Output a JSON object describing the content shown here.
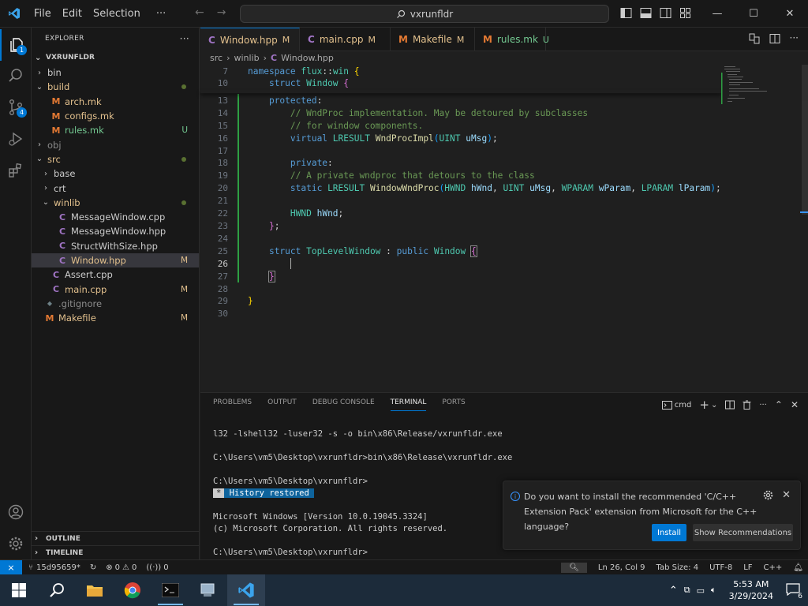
{
  "titlebar": {
    "menu": [
      "File",
      "Edit",
      "Selection",
      "···"
    ],
    "search_text": "vxrunfldr"
  },
  "activitybar": {
    "explorer_badge": "1",
    "scm_badge": "4"
  },
  "sidebar": {
    "title": "EXPLORER",
    "more": "···",
    "root": "VXRUNFLDR",
    "tree": [
      {
        "label": "bin",
        "depth": 1,
        "chevron": "›",
        "icon": "",
        "status": ""
      },
      {
        "label": "build",
        "depth": 1,
        "chevron": "⌄",
        "icon": "",
        "status": "dot",
        "color": "mod"
      },
      {
        "label": "arch.mk",
        "depth": 2,
        "chevron": "",
        "icon": "M",
        "status": "",
        "color": "mod"
      },
      {
        "label": "configs.mk",
        "depth": 2,
        "chevron": "",
        "icon": "M",
        "status": "",
        "color": "mod"
      },
      {
        "label": "rules.mk",
        "depth": 2,
        "chevron": "",
        "icon": "M",
        "status": "U",
        "color": "unt"
      },
      {
        "label": "obj",
        "depth": 1,
        "chevron": "›",
        "icon": "",
        "status": "",
        "color": "dim"
      },
      {
        "label": "src",
        "depth": 1,
        "chevron": "⌄",
        "icon": "",
        "status": "dot",
        "color": "mod"
      },
      {
        "label": "base",
        "depth": 2,
        "chevron": "›",
        "icon": "",
        "status": ""
      },
      {
        "label": "crt",
        "depth": 2,
        "chevron": "›",
        "icon": "",
        "status": ""
      },
      {
        "label": "winlib",
        "depth": 2,
        "chevron": "⌄",
        "icon": "",
        "status": "dot",
        "color": "mod"
      },
      {
        "label": "MessageWindow.cpp",
        "depth": 3,
        "chevron": "",
        "icon": "C",
        "status": ""
      },
      {
        "label": "MessageWindow.hpp",
        "depth": 3,
        "chevron": "",
        "icon": "C",
        "status": ""
      },
      {
        "label": "StructWithSize.hpp",
        "depth": 3,
        "chevron": "",
        "icon": "C",
        "status": ""
      },
      {
        "label": "Window.hpp",
        "depth": 3,
        "chevron": "",
        "icon": "C",
        "status": "M",
        "color": "mod",
        "selected": true
      },
      {
        "label": "Assert.cpp",
        "depth": 2,
        "chevron": "",
        "icon": "C",
        "status": ""
      },
      {
        "label": "main.cpp",
        "depth": 2,
        "chevron": "",
        "icon": "C",
        "status": "M",
        "color": "mod"
      },
      {
        "label": ".gitignore",
        "depth": 1,
        "chevron": "",
        "icon": "◆",
        "status": "",
        "color": "dim"
      },
      {
        "label": "Makefile",
        "depth": 1,
        "chevron": "",
        "icon": "M",
        "status": "M",
        "color": "mod"
      }
    ],
    "outline": "OUTLINE",
    "timeline": "TIMELINE"
  },
  "tabs": [
    {
      "label": "Window.hpp",
      "status": "M",
      "active": true,
      "dirty": true,
      "icon": "C"
    },
    {
      "label": "main.cpp",
      "status": "M",
      "active": false,
      "icon": "C"
    },
    {
      "label": "Makefile",
      "status": "M",
      "active": false,
      "icon": "M"
    },
    {
      "label": "rules.mk",
      "status": "U",
      "active": false,
      "icon": "M"
    }
  ],
  "breadcrumb": [
    "src",
    "winlib",
    "Window.hpp"
  ],
  "editor": {
    "lines": [
      {
        "n": "7",
        "g": false,
        "html": "<span class='kw'>namespace</span> <span class='ty'>flux</span><span class='op'>::</span><span class='ty'>win</span> <span class='br1'>{</span>"
      },
      {
        "n": "10",
        "g": false,
        "html": "    <span class='kw'>struct</span> <span class='ty'>Window</span> <span class='br2'>{</span>"
      },
      {
        "n": "13",
        "g": true,
        "html": "    <span class='kw'>protected</span><span class='op'>:</span>"
      },
      {
        "n": "14",
        "g": true,
        "html": "        <span class='cm'>// WndProc implementation. May be detoured by subclasses</span>"
      },
      {
        "n": "15",
        "g": true,
        "html": "        <span class='cm'>// for window components.</span>"
      },
      {
        "n": "16",
        "g": true,
        "html": "        <span class='kw'>virtual</span> <span class='ty'>LRESULT</span> <span class='fn'>WndProcImpl</span><span class='br3'>(</span><span class='ty'>UINT</span> <span class='pm'>uMsg</span><span class='br3'>)</span><span class='op'>;</span>"
      },
      {
        "n": "17",
        "g": true,
        "html": ""
      },
      {
        "n": "18",
        "g": true,
        "html": "        <span class='kw'>private</span><span class='op'>:</span>"
      },
      {
        "n": "19",
        "g": true,
        "html": "        <span class='cm'>// A private wndproc that detours to the class</span>"
      },
      {
        "n": "20",
        "g": true,
        "html": "        <span class='kw'>static</span> <span class='ty'>LRESULT</span> <span class='fn'>WindowWndProc</span><span class='br3'>(</span><span class='ty'>HWND</span> <span class='pm'>hWnd</span><span class='op'>,</span> <span class='ty'>UINT</span> <span class='pm'>uMsg</span><span class='op'>,</span> <span class='ty'>WPARAM</span> <span class='pm'>wParam</span><span class='op'>,</span> <span class='ty'>LPARAM</span> <span class='pm'>lParam</span><span class='br3'>)</span><span class='op'>;</span>"
      },
      {
        "n": "21",
        "g": true,
        "html": ""
      },
      {
        "n": "22",
        "g": true,
        "html": "        <span class='ty'>HWND</span> <span class='pm'>hWnd</span><span class='op'>;</span>"
      },
      {
        "n": "23",
        "g": true,
        "html": "    <span class='br2'>}</span><span class='op'>;</span>"
      },
      {
        "n": "24",
        "g": true,
        "html": ""
      },
      {
        "n": "25",
        "g": true,
        "html": "    <span class='kw'>struct</span> <span class='ty'>TopLevelWindow</span> <span class='op'>:</span> <span class='kw'>public</span> <span class='ty'>Window</span> <span class='br2' style='outline:1px solid #888'>{</span>"
      },
      {
        "n": "26",
        "g": true,
        "cur": true,
        "html": "        <span class='cursor'></span>"
      },
      {
        "n": "27",
        "g": true,
        "html": "    <span class='br2' style='outline:1px solid #888'>}</span>"
      },
      {
        "n": "28",
        "g": false,
        "html": ""
      },
      {
        "n": "29",
        "g": false,
        "html": "<span class='br1'>}</span>"
      },
      {
        "n": "30",
        "g": false,
        "html": ""
      }
    ]
  },
  "panel": {
    "tabs": [
      "PROBLEMS",
      "OUTPUT",
      "DEBUG CONSOLE",
      "TERMINAL",
      "PORTS"
    ],
    "active_tab": "TERMINAL",
    "shell": "cmd",
    "terminal_lines": [
      "l32 -lshell32 -luser32 -s -o bin\\x86\\Release/vxrunfldr.exe",
      "",
      "C:\\Users\\vm5\\Desktop\\vxrunfldr>bin\\x86\\Release\\vxrunfldr.exe",
      "",
      "C:\\Users\\vm5\\Desktop\\vxrunfldr>",
      "__HISTORY__",
      "",
      "Microsoft Windows [Version 10.0.19045.3324]",
      "(c) Microsoft Corporation. All rights reserved.",
      "",
      "C:\\Users\\vm5\\Desktop\\vxrunfldr>"
    ],
    "history_star": "*",
    "history_text": " History restored "
  },
  "toast": {
    "message": "Do you want to install the recommended 'C/C++ Extension Pack' extension from Microsoft for the C++ language?",
    "install": "Install",
    "show": "Show Recommendations"
  },
  "statusbar": {
    "branch": "15d95659*",
    "errors": "0",
    "warnings": "0",
    "ports": "0",
    "position": "Ln 26, Col 9",
    "tabsize": "Tab Size: 4",
    "encoding": "UTF-8",
    "eol": "LF",
    "language": "C++"
  },
  "taskbar": {
    "time": "5:53 AM",
    "date": "3/29/2024",
    "notif_count": "6"
  },
  "colors": {
    "accent": "#0078d4",
    "modified": "#e2c08d",
    "untracked": "#73c991",
    "added_gutter": "#2ea043"
  }
}
